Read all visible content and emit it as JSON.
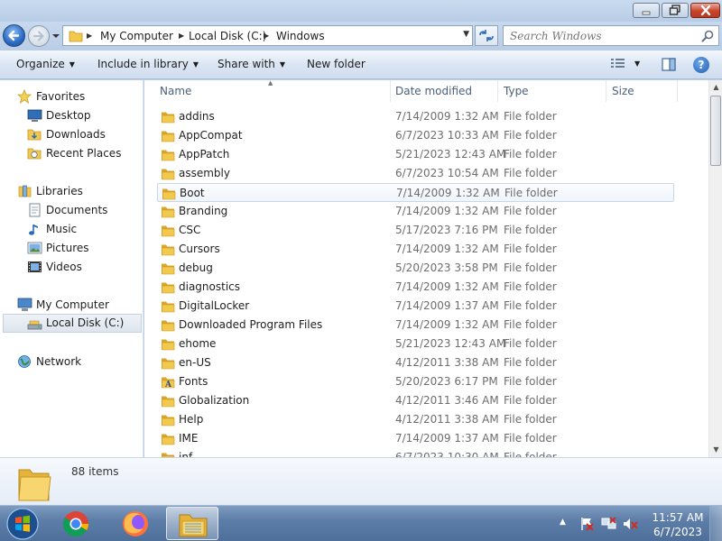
{
  "window": {
    "caption_buttons": [
      "minimize",
      "maximize",
      "close"
    ]
  },
  "address": {
    "breadcrumbs": [
      "My Computer",
      "Local Disk (C:)",
      "Windows"
    ]
  },
  "search": {
    "placeholder": "Search Windows"
  },
  "toolbar": {
    "organize": "Organize",
    "include_in_library": "Include in library",
    "share_with": "Share with",
    "new_folder": "New folder"
  },
  "sidebar": {
    "favorites": "Favorites",
    "desktop": "Desktop",
    "downloads": "Downloads",
    "recent_places": "Recent Places",
    "libraries": "Libraries",
    "documents": "Documents",
    "music": "Music",
    "pictures": "Pictures",
    "videos": "Videos",
    "my_computer": "My Computer",
    "local_disk": "Local Disk (C:)",
    "network": "Network"
  },
  "columns": {
    "name": "Name",
    "date_modified": "Date modified",
    "type": "Type",
    "size": "Size"
  },
  "files": [
    {
      "name": "addins",
      "date": "7/14/2009 1:32 AM",
      "type": "File folder"
    },
    {
      "name": "AppCompat",
      "date": "6/7/2023 10:33 AM",
      "type": "File folder"
    },
    {
      "name": "AppPatch",
      "date": "5/21/2023 12:43 AM",
      "type": "File folder"
    },
    {
      "name": "assembly",
      "date": "6/7/2023 10:54 AM",
      "type": "File folder"
    },
    {
      "name": "Boot",
      "date": "7/14/2009 1:32 AM",
      "type": "File folder"
    },
    {
      "name": "Branding",
      "date": "7/14/2009 1:32 AM",
      "type": "File folder"
    },
    {
      "name": "CSC",
      "date": "5/17/2023 7:16 PM",
      "type": "File folder"
    },
    {
      "name": "Cursors",
      "date": "7/14/2009 1:32 AM",
      "type": "File folder"
    },
    {
      "name": "debug",
      "date": "5/20/2023 3:58 PM",
      "type": "File folder"
    },
    {
      "name": "diagnostics",
      "date": "7/14/2009 1:32 AM",
      "type": "File folder"
    },
    {
      "name": "DigitalLocker",
      "date": "7/14/2009 1:37 AM",
      "type": "File folder"
    },
    {
      "name": "Downloaded Program Files",
      "date": "7/14/2009 1:32 AM",
      "type": "File folder"
    },
    {
      "name": "ehome",
      "date": "5/21/2023 12:43 AM",
      "type": "File folder"
    },
    {
      "name": "en-US",
      "date": "4/12/2011 3:38 AM",
      "type": "File folder"
    },
    {
      "name": "Fonts",
      "date": "5/20/2023 6:17 PM",
      "type": "File folder"
    },
    {
      "name": "Globalization",
      "date": "4/12/2011 3:46 AM",
      "type": "File folder"
    },
    {
      "name": "Help",
      "date": "4/12/2011 3:38 AM",
      "type": "File folder"
    },
    {
      "name": "IME",
      "date": "7/14/2009 1:37 AM",
      "type": "File folder"
    },
    {
      "name": "inf",
      "date": "6/7/2023 10:30 AM",
      "type": "File folder"
    }
  ],
  "details": {
    "item_count": "88 items"
  },
  "taskbar": {
    "apps": [
      "chrome",
      "firefox",
      "windows-explorer"
    ],
    "time": "11:57 AM",
    "date": "6/7/2023"
  },
  "colors": {
    "folder": "#f2c94c",
    "folder_dark": "#d9a52b",
    "accent": "#1f5db3",
    "hover_border": "#c7d7ea"
  }
}
